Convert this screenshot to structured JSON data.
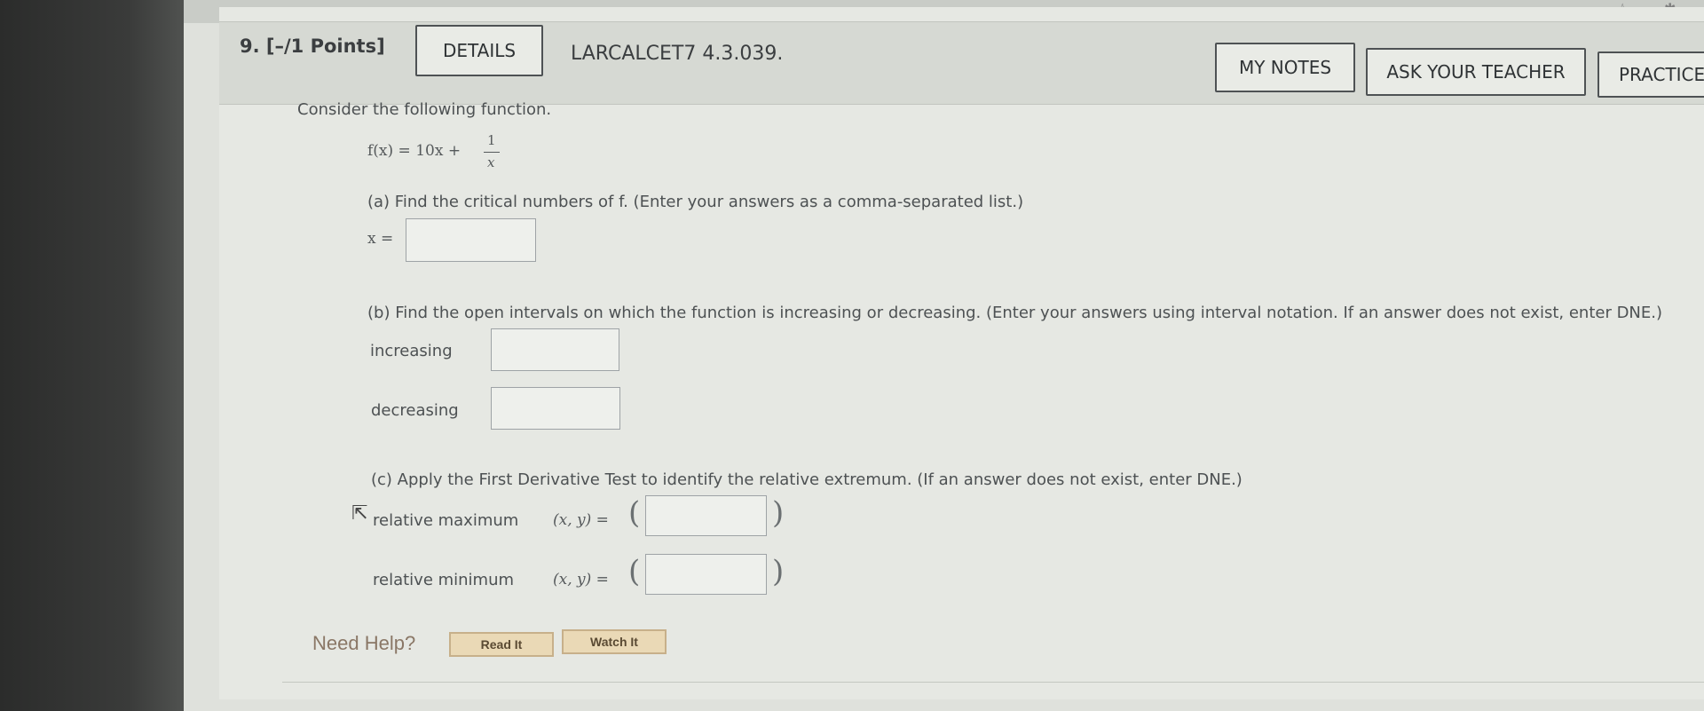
{
  "header": {
    "question_number": "9. [–/1 Points]",
    "details_label": "DETAILS",
    "question_id": "LARCALCET7 4.3.039.",
    "my_notes_label": "MY NOTES",
    "ask_teacher_label": "ASK YOUR TEACHER",
    "practice_label": "PRACTICE"
  },
  "problem": {
    "intro": "Consider the following function.",
    "function_lhs": "f(x) = 10x +",
    "fraction_num": "1",
    "fraction_den": "x",
    "part_a": "(a) Find the critical numbers of f. (Enter your answers as a comma-separated list.)",
    "part_a_lhs": "x =",
    "part_b": "(b) Find the open intervals on which the function is increasing or decreasing. (Enter your answers using interval notation. If an answer does not exist, enter DNE.)",
    "increasing_label": "increasing",
    "decreasing_label": "decreasing",
    "part_c": "(c) Apply the First Derivative Test to identify the relative extremum. (If an answer does not exist, enter DNE.)",
    "rel_max_label": "relative maximum",
    "rel_min_label": "relative minimum",
    "xy_lhs": "(x, y) =",
    "open_paren": "(",
    "close_paren": ")"
  },
  "help": {
    "label": "Need Help?",
    "read_it": "Read It",
    "watch_it": "Watch It"
  },
  "icons": {
    "cursor": "arrow-cursor-icon",
    "top_bar": [
      "window-icon",
      "star-icon",
      "extension-icon"
    ]
  }
}
